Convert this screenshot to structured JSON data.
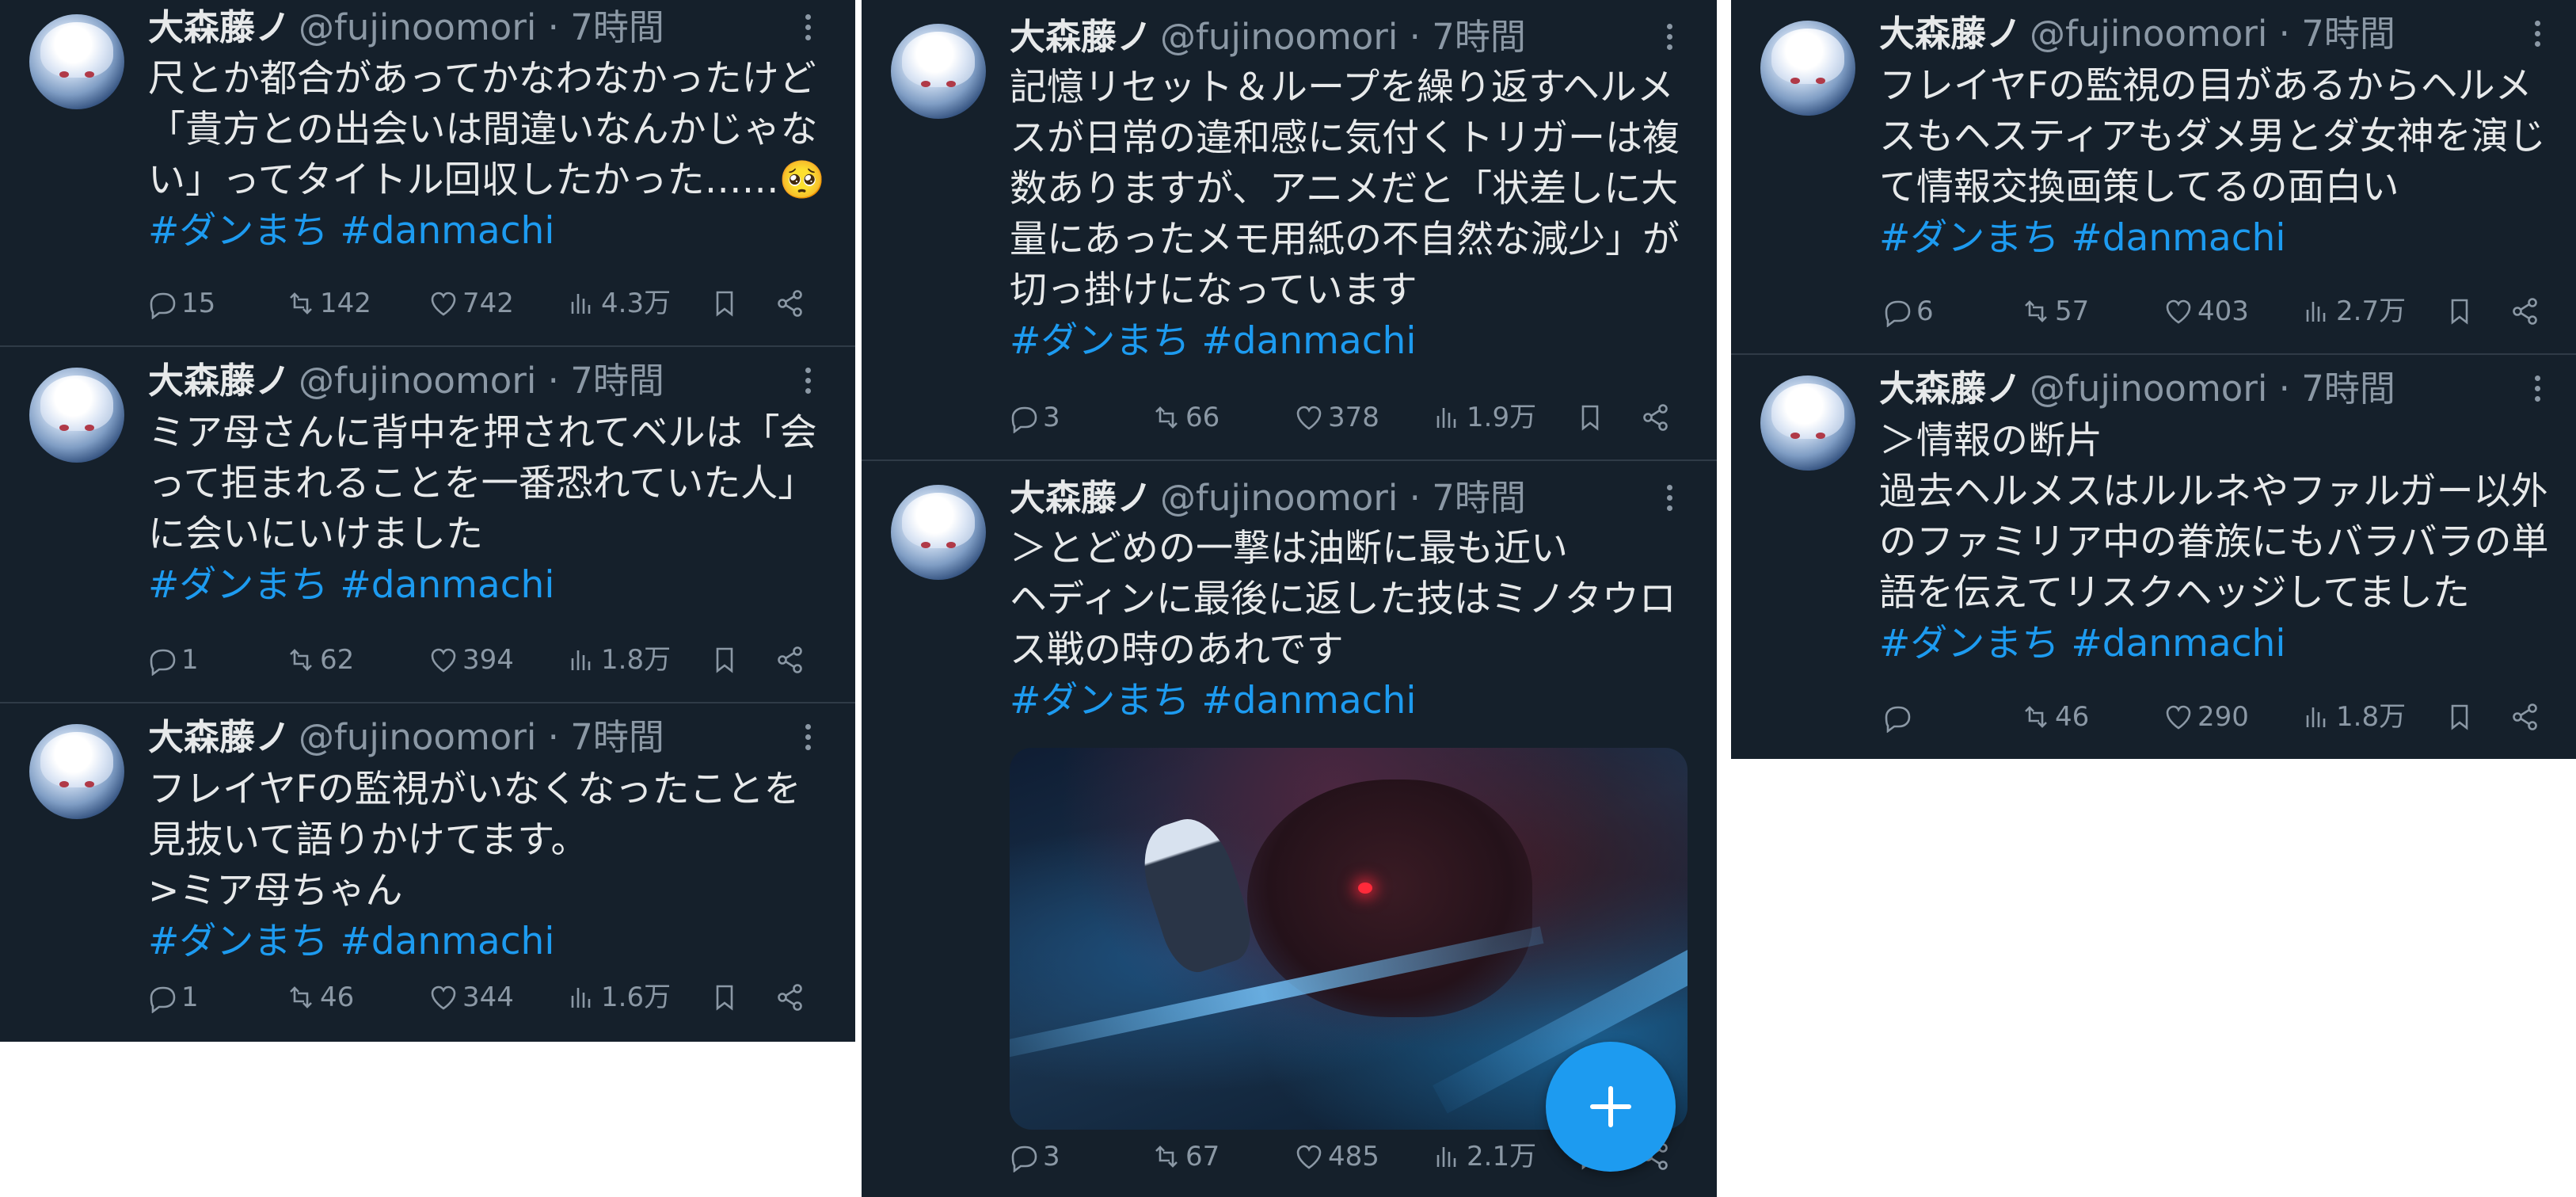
{
  "author": {
    "name": "大森藤ノ",
    "handle": "@fujinoomori",
    "time": "· 7時間"
  },
  "hashtags": "#ダンまち #danmachi",
  "icons": {
    "reply": "speech-bubble-icon",
    "repost": "repost-arrows-icon",
    "like": "heart-icon",
    "views": "bar-chart-icon",
    "bookmark": "bookmark-icon",
    "share": "share-icon",
    "more": "kebab-menu-icon",
    "compose": "plus-icon"
  },
  "colors": {
    "background": "#15202b",
    "link": "#1d9bf0",
    "text": "#e7e9ea",
    "muted": "#8b98a5",
    "fab": "#1d9bf0"
  },
  "tweets": [
    {
      "lines": [
        "尺とか都合があってかなわなかったけど",
        "「貴方との出会いは間違いなんかじゃな",
        "い」ってタイトル回収したかった……🥺"
      ],
      "replies": "15",
      "reposts": "142",
      "likes": "742",
      "views": "4.3万"
    },
    {
      "lines": [
        "ミア母さんに背中を押されてベルは「会",
        "って拒まれることを一番恐れていた人」",
        "に会いにいけました"
      ],
      "replies": "1",
      "reposts": "62",
      "likes": "394",
      "views": "1.8万"
    },
    {
      "lines": [
        "フレイヤFの監視がいなくなったことを",
        "見抜いて語りかけてます。",
        ">ミア母ちゃん"
      ],
      "replies": "1",
      "reposts": "46",
      "likes": "344",
      "views": "1.6万"
    },
    {
      "lines": [
        "記憶リセット＆ループを繰り返すヘルメ",
        "スが日常の違和感に気付くトリガーは複",
        "数ありますが、アニメだと「状差しに大",
        "量にあったメモ用紙の不自然な減少」が",
        "切っ掛けになっています"
      ],
      "replies": "3",
      "reposts": "66",
      "likes": "378",
      "views": "1.9万"
    },
    {
      "lines": [
        "＞とどめの一撃は油断に最も近い",
        "ヘディンに最後に返した技はミノタウロ",
        "ス戦の時のあれです"
      ],
      "replies": "3",
      "reposts": "67",
      "likes": "485",
      "views": "2.1万",
      "has_media": true
    },
    {
      "lines": [
        "フレイヤFの監視の目があるからヘルメ",
        "スもヘスティアもダメ男とダ女神を演じ",
        "て情報交換画策してるの面白い"
      ],
      "replies": "6",
      "reposts": "57",
      "likes": "403",
      "views": "2.7万"
    },
    {
      "lines": [
        "＞情報の断片",
        "過去ヘルメスはルルネやファルガー以外",
        "のファミリア中の眷族にもバラバラの単",
        "語を伝えてリスクヘッジしてました"
      ],
      "replies": "",
      "reposts": "46",
      "likes": "290",
      "views": "1.8万"
    }
  ]
}
